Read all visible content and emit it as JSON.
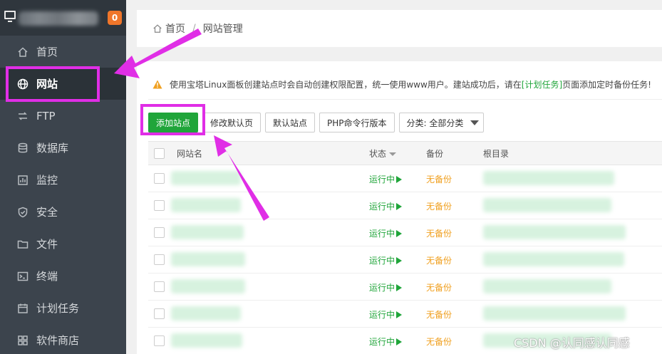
{
  "sidebar": {
    "badge": "0",
    "items": [
      {
        "label": "首页",
        "icon": "home-icon"
      },
      {
        "label": "网站",
        "icon": "globe-icon",
        "active": true
      },
      {
        "label": "FTP",
        "icon": "ftp-icon"
      },
      {
        "label": "数据库",
        "icon": "database-icon"
      },
      {
        "label": "监控",
        "icon": "monitor-chart-icon"
      },
      {
        "label": "安全",
        "icon": "shield-icon"
      },
      {
        "label": "文件",
        "icon": "folder-icon"
      },
      {
        "label": "终端",
        "icon": "terminal-icon"
      },
      {
        "label": "计划任务",
        "icon": "calendar-icon"
      },
      {
        "label": "软件商店",
        "icon": "grid-icon"
      }
    ]
  },
  "breadcrumb": {
    "home": "首页",
    "separator": "/",
    "current": "网站管理"
  },
  "notice": {
    "text_before": "使用宝塔Linux面板创建站点时会自动创建权限配置，统一使用www用户。建站成功后，请在",
    "link": "[计划任务]",
    "text_after": "页面添加定时备份任务!"
  },
  "toolbar": {
    "add_site": "添加站点",
    "edit_default_page": "修改默认页",
    "default_site": "默认站点",
    "php_cli_version": "PHP命令行版本",
    "category_select": "分类: 全部分类"
  },
  "table": {
    "headers": {
      "name": "网站名",
      "status": "状态",
      "backup": "备份",
      "root": "根目录"
    },
    "rows": [
      {
        "status": "运行中",
        "backup": "无备份"
      },
      {
        "status": "运行中",
        "backup": "无备份"
      },
      {
        "status": "运行中",
        "backup": "无备份"
      },
      {
        "status": "运行中",
        "backup": "无备份"
      },
      {
        "status": "运行中",
        "backup": "无备份"
      },
      {
        "status": "运行中",
        "backup": "无备份"
      },
      {
        "status": "运行中",
        "backup": "无备份"
      }
    ]
  },
  "watermark": "CSDN @认同感认同感",
  "colors": {
    "accent_green": "#20a53a",
    "highlight_magenta": "#e02ee6",
    "warning_orange": "#f0a020",
    "sidebar_bg": "#3c444d"
  }
}
